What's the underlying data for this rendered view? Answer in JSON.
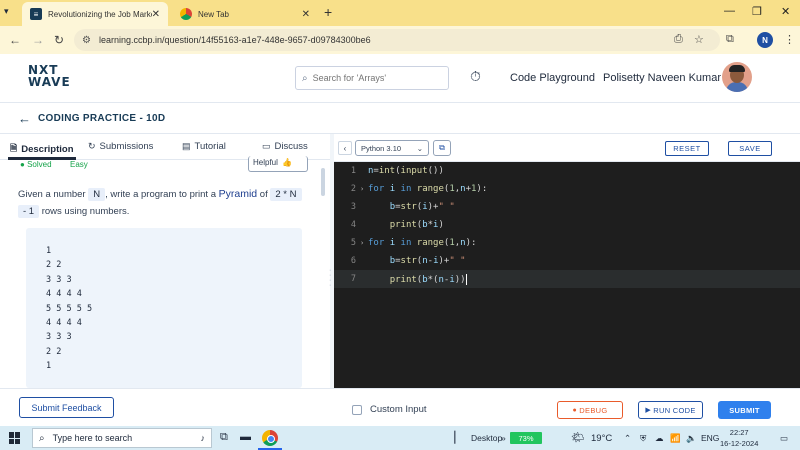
{
  "browser": {
    "tabs": [
      {
        "title": "Revolutionizing the Job Market",
        "active": true
      },
      {
        "title": "New Tab",
        "active": false
      }
    ],
    "new_tab_symbol": "+",
    "url": "learning.ccbp.in/question/14f55163-a1e7-448e-9657-d09784300be6",
    "profile_initial": "N"
  },
  "site": {
    "logo_line1": "NXT",
    "logo_line2": "WAVE",
    "search_placeholder": "Search for 'Arrays'",
    "code_playground": "Code Playground",
    "user_name": "Polisetty Naveen Kumar"
  },
  "practice": {
    "title": "CODING PRACTICE - 10D"
  },
  "left_tabs": [
    {
      "label": "Description",
      "icon": "document-icon"
    },
    {
      "label": "Submissions",
      "icon": "refresh-icon"
    },
    {
      "label": "Tutorial",
      "icon": "notebook-icon"
    },
    {
      "label": "Discuss",
      "icon": "chat-icon"
    }
  ],
  "status": {
    "solved": "Solved",
    "difficulty": "Easy",
    "helpful": "Helpful"
  },
  "description": {
    "part1": "Given a number",
    "n_chip": "N",
    "part2": ", write a program to print a",
    "pyramid": "Pyramid",
    "part3": "of",
    "chip2": "2 * N",
    "chip3": "- 1",
    "part4": "rows using numbers."
  },
  "sample_output": [
    "1",
    "2 2",
    "3 3 3",
    "4 4 4 4",
    "5 5 5 5 5",
    "4 4 4 4",
    "3 3 3",
    "2 2",
    "1"
  ],
  "editor": {
    "language": "Python 3.10",
    "reset": "RESET",
    "save": "SAVE",
    "lines": [
      {
        "num": "1",
        "fold": false,
        "indent": "",
        "tokens": [
          [
            "var",
            "n"
          ],
          [
            "op",
            "="
          ],
          [
            "fn",
            "int"
          ],
          [
            "op",
            "("
          ],
          [
            "fn",
            "input"
          ],
          [
            "op",
            "())"
          ]
        ]
      },
      {
        "num": "2",
        "fold": true,
        "indent": "",
        "tokens": [
          [
            "kw",
            "for"
          ],
          [
            "op",
            " "
          ],
          [
            "var",
            "i"
          ],
          [
            "op",
            " "
          ],
          [
            "kw",
            "in"
          ],
          [
            "op",
            " "
          ],
          [
            "fn",
            "range"
          ],
          [
            "op",
            "("
          ],
          [
            "num",
            "1"
          ],
          [
            "op",
            ","
          ],
          [
            "var",
            "n"
          ],
          [
            "op",
            "+"
          ],
          [
            "num",
            "1"
          ],
          [
            "op",
            "):"
          ]
        ]
      },
      {
        "num": "3",
        "fold": false,
        "indent": "    ",
        "tokens": [
          [
            "var",
            "b"
          ],
          [
            "op",
            "="
          ],
          [
            "fn",
            "str"
          ],
          [
            "op",
            "("
          ],
          [
            "var",
            "i"
          ],
          [
            "op",
            ")+"
          ],
          [
            "str",
            "\" \""
          ]
        ]
      },
      {
        "num": "4",
        "fold": false,
        "indent": "    ",
        "tokens": [
          [
            "fn",
            "print"
          ],
          [
            "op",
            "("
          ],
          [
            "var",
            "b"
          ],
          [
            "op",
            "*"
          ],
          [
            "var",
            "i"
          ],
          [
            "op",
            ")"
          ]
        ]
      },
      {
        "num": "5",
        "fold": true,
        "indent": "",
        "tokens": [
          [
            "kw",
            "for"
          ],
          [
            "op",
            " "
          ],
          [
            "var",
            "i"
          ],
          [
            "op",
            " "
          ],
          [
            "kw",
            "in"
          ],
          [
            "op",
            " "
          ],
          [
            "fn",
            "range"
          ],
          [
            "op",
            "("
          ],
          [
            "num",
            "1"
          ],
          [
            "op",
            ","
          ],
          [
            "var",
            "n"
          ],
          [
            "op",
            "):"
          ]
        ]
      },
      {
        "num": "6",
        "fold": false,
        "indent": "    ",
        "tokens": [
          [
            "var",
            "b"
          ],
          [
            "op",
            "="
          ],
          [
            "fn",
            "str"
          ],
          [
            "op",
            "("
          ],
          [
            "var",
            "n"
          ],
          [
            "op",
            "-"
          ],
          [
            "var",
            "i"
          ],
          [
            "op",
            ")+"
          ],
          [
            "str",
            "\" \""
          ]
        ]
      },
      {
        "num": "7",
        "fold": false,
        "indent": "    ",
        "current": true,
        "tokens": [
          [
            "fn",
            "print"
          ],
          [
            "op",
            "("
          ],
          [
            "var",
            "b"
          ],
          [
            "op",
            "*("
          ],
          [
            "var",
            "n"
          ],
          [
            "op",
            "-"
          ],
          [
            "var",
            "i"
          ],
          [
            "op",
            "))"
          ]
        ]
      }
    ]
  },
  "actions": {
    "feedback": "Submit Feedback",
    "custom_input": "Custom Input",
    "debug": "DEBUG",
    "run_code": "RUN CODE",
    "submit": "SUBMIT"
  },
  "taskbar": {
    "search_placeholder": "Type here to search",
    "desktop": "Desktop",
    "battery": "73%",
    "temperature": "19°C",
    "language": "ENG",
    "time": "22:27",
    "date": "16-12-2024"
  },
  "colors": {
    "brand": "#183b56",
    "primary": "#2f80ed",
    "debug": "#e95b2b",
    "editor_bg": "#1e1e1e"
  }
}
